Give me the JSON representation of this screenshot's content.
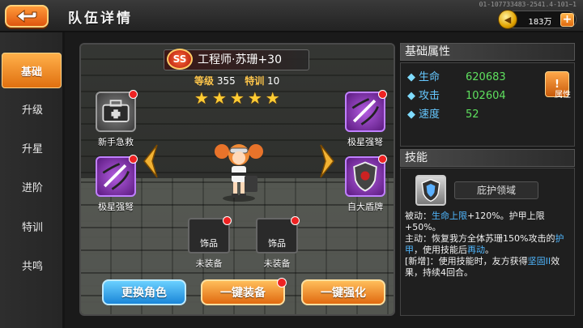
{
  "build_id": "01-107733483-2541.4-101~1",
  "header": {
    "title": "队伍详情",
    "coins": "183万"
  },
  "sidebar": {
    "items": [
      {
        "label": "基础"
      },
      {
        "label": "升级"
      },
      {
        "label": "升星"
      },
      {
        "label": "进阶"
      },
      {
        "label": "特训"
      },
      {
        "label": "共鸣"
      }
    ],
    "active_index": 0
  },
  "hero": {
    "rank": "SS",
    "name": "工程师·苏珊+30",
    "level_label": "等级",
    "level": "355",
    "train_label": "特训",
    "train": "10",
    "stars": 5
  },
  "equipment": {
    "left_top": "新手急救",
    "left_bottom": "极星强弩",
    "right_top": "极星强弩",
    "right_bottom": "自大盾牌",
    "slot_label": "饰品",
    "slot_status": "未装备"
  },
  "buttons": {
    "change": "更换角色",
    "equip_all": "一键装备",
    "enhance_all": "一键强化"
  },
  "attributes": {
    "title": "基础属性",
    "button_label": "属性",
    "rows": [
      {
        "name": "生命",
        "value": "620683"
      },
      {
        "name": "攻击",
        "value": "102604"
      },
      {
        "name": "速度",
        "value": "52"
      }
    ]
  },
  "skill": {
    "title": "技能",
    "name": "庇护领域",
    "passive_prefix": "被动：",
    "passive_hl": "生命上限",
    "passive_rest": "+120%。护甲上限+50%。",
    "active_prefix": "主动：恢复我方全体苏珊150%攻击的",
    "active_hl1": "护甲",
    "active_mid": "，使用技能后",
    "active_hl2": "再动",
    "active_end": "。",
    "new_prefix": "[新增]：使用技能时，友方获得",
    "new_hl": "坚固II",
    "new_rest": "效果，持续4回合。"
  },
  "colors": {
    "accent_orange": "#e07010",
    "button_blue": "#1a86d8",
    "stat_green": "#5ee05e",
    "stat_name_blue": "#66c8ff"
  }
}
